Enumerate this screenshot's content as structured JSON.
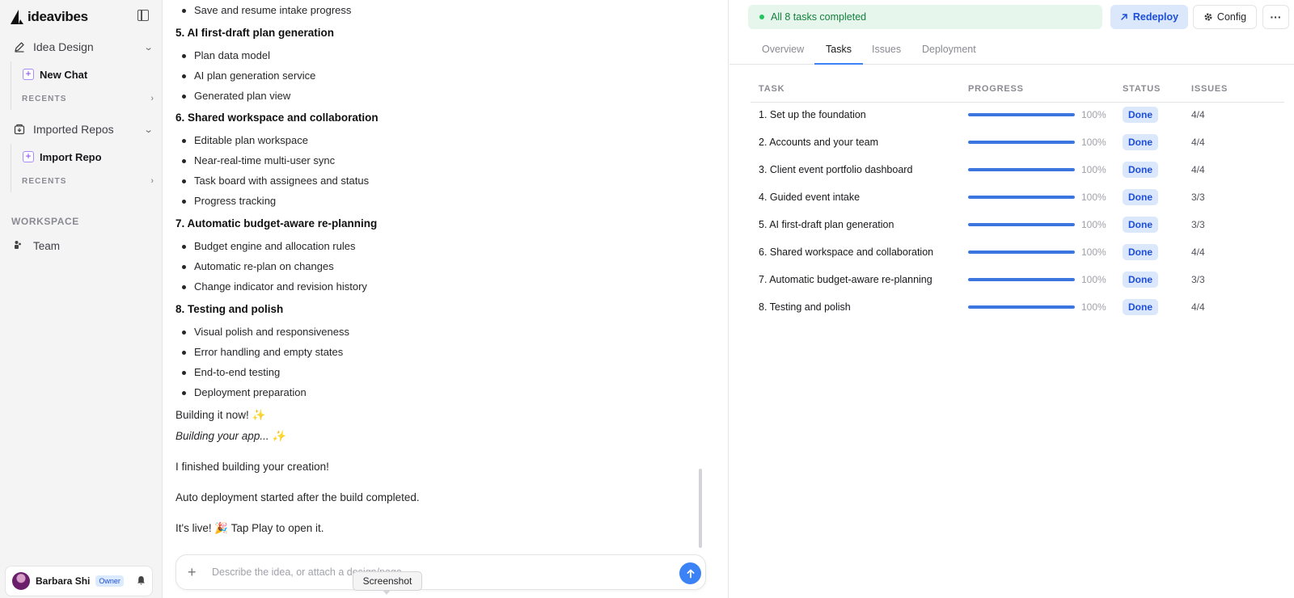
{
  "sidebar": {
    "brand": "ideavibes",
    "sections": [
      {
        "label": "Idea Design",
        "sub_label": "New Chat",
        "recents": "RECENTS"
      },
      {
        "label": "Imported Repos",
        "sub_label": "Import Repo",
        "recents": "RECENTS"
      }
    ],
    "workspace_label": "WORKSPACE",
    "team_label": "Team",
    "user": {
      "name": "Barbara Shi",
      "role": "Owner"
    }
  },
  "chat": {
    "lines": [
      {
        "kind": "li",
        "text": "Save and resume intake progress"
      },
      {
        "kind": "h",
        "text": "5. AI first-draft plan generation"
      },
      {
        "kind": "li",
        "text": "Plan data model"
      },
      {
        "kind": "li",
        "text": "AI plan generation service"
      },
      {
        "kind": "li",
        "text": "Generated plan view"
      },
      {
        "kind": "h",
        "text": "6. Shared workspace and collaboration"
      },
      {
        "kind": "li",
        "text": "Editable plan workspace"
      },
      {
        "kind": "li",
        "text": "Near-real-time multi-user sync"
      },
      {
        "kind": "li",
        "text": "Task board with assignees and status"
      },
      {
        "kind": "li",
        "text": "Progress tracking"
      },
      {
        "kind": "h",
        "text": "7. Automatic budget-aware re-planning"
      },
      {
        "kind": "li",
        "text": "Budget engine and allocation rules"
      },
      {
        "kind": "li",
        "text": "Automatic re-plan on changes"
      },
      {
        "kind": "li",
        "text": "Change indicator and revision history"
      },
      {
        "kind": "h",
        "text": "8. Testing and polish"
      },
      {
        "kind": "li",
        "text": "Visual polish and responsiveness"
      },
      {
        "kind": "li",
        "text": "Error handling and empty states"
      },
      {
        "kind": "li",
        "text": "End-to-end testing"
      },
      {
        "kind": "li",
        "text": "Deployment preparation"
      },
      {
        "kind": "p",
        "text": "Building it now! ✨"
      },
      {
        "kind": "pi",
        "text": "Building your app... ✨"
      },
      {
        "kind": "p",
        "text": "I finished building your creation!"
      },
      {
        "kind": "p",
        "text": "Auto deployment started after the build completed."
      },
      {
        "kind": "p",
        "text": "It's live! 🎉 Tap Play to open it."
      }
    ],
    "composer_placeholder": "Describe the idea, or attach a design/page",
    "tooltip": "Screenshot"
  },
  "panel": {
    "status": "All 8 tasks completed",
    "redeploy_label": "Redeploy",
    "config_label": "Config",
    "more_label": "···",
    "tabs": [
      "Overview",
      "Tasks",
      "Issues",
      "Deployment"
    ],
    "active_tab": "Tasks",
    "columns": [
      "TASK",
      "PROGRESS",
      "STATUS",
      "ISSUES"
    ],
    "rows": [
      {
        "task": "1. Set up the foundation",
        "progress": 100,
        "progress_label": "100%",
        "status": "Done",
        "issues": "4/4"
      },
      {
        "task": "2. Accounts and your team",
        "progress": 100,
        "progress_label": "100%",
        "status": "Done",
        "issues": "4/4"
      },
      {
        "task": "3. Client event portfolio dashboard",
        "progress": 100,
        "progress_label": "100%",
        "status": "Done",
        "issues": "4/4"
      },
      {
        "task": "4. Guided event intake",
        "progress": 100,
        "progress_label": "100%",
        "status": "Done",
        "issues": "3/3"
      },
      {
        "task": "5. AI first-draft plan generation",
        "progress": 100,
        "progress_label": "100%",
        "status": "Done",
        "issues": "3/3"
      },
      {
        "task": "6. Shared workspace and collaboration",
        "progress": 100,
        "progress_label": "100%",
        "status": "Done",
        "issues": "4/4"
      },
      {
        "task": "7. Automatic budget-aware re-planning",
        "progress": 100,
        "progress_label": "100%",
        "status": "Done",
        "issues": "3/3"
      },
      {
        "task": "8. Testing and polish",
        "progress": 100,
        "progress_label": "100%",
        "status": "Done",
        "issues": "4/4"
      }
    ]
  }
}
